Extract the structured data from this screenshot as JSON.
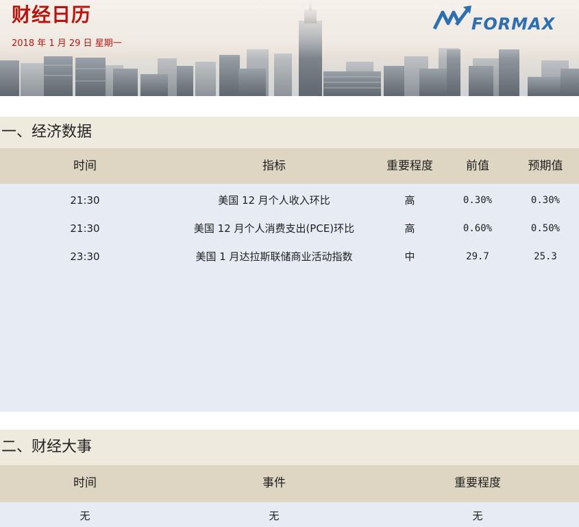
{
  "header": {
    "title": "财经日历",
    "date": "2018 年 1 月 29 日  星期一",
    "logo_text": "FORMAX",
    "brand_color": "#b8140d",
    "logo_color": "#2d6fb0"
  },
  "economic_data": {
    "section_title": "一、经济数据",
    "columns": [
      "时间",
      "指标",
      "重要程度",
      "前值",
      "预期值"
    ],
    "rows": [
      {
        "time": "21:30",
        "indicator": "美国 12 月个人收入环比",
        "importance": "高",
        "previous": "0.30%",
        "forecast": "0.30%"
      },
      {
        "time": "21:30",
        "indicator": "美国 12 月个人消费支出(PCE)环比",
        "importance": "高",
        "previous": "0.60%",
        "forecast": "0.50%"
      },
      {
        "time": "23:30",
        "indicator": "美国 1 月达拉斯联储商业活动指数",
        "importance": "中",
        "previous": "29.7",
        "forecast": "25.3"
      }
    ]
  },
  "financial_events": {
    "section_title": "二、财经大事",
    "columns": [
      "时间",
      "事件",
      "重要程度"
    ],
    "rows": [
      {
        "time": "无",
        "event": "无",
        "importance": "无"
      }
    ]
  }
}
